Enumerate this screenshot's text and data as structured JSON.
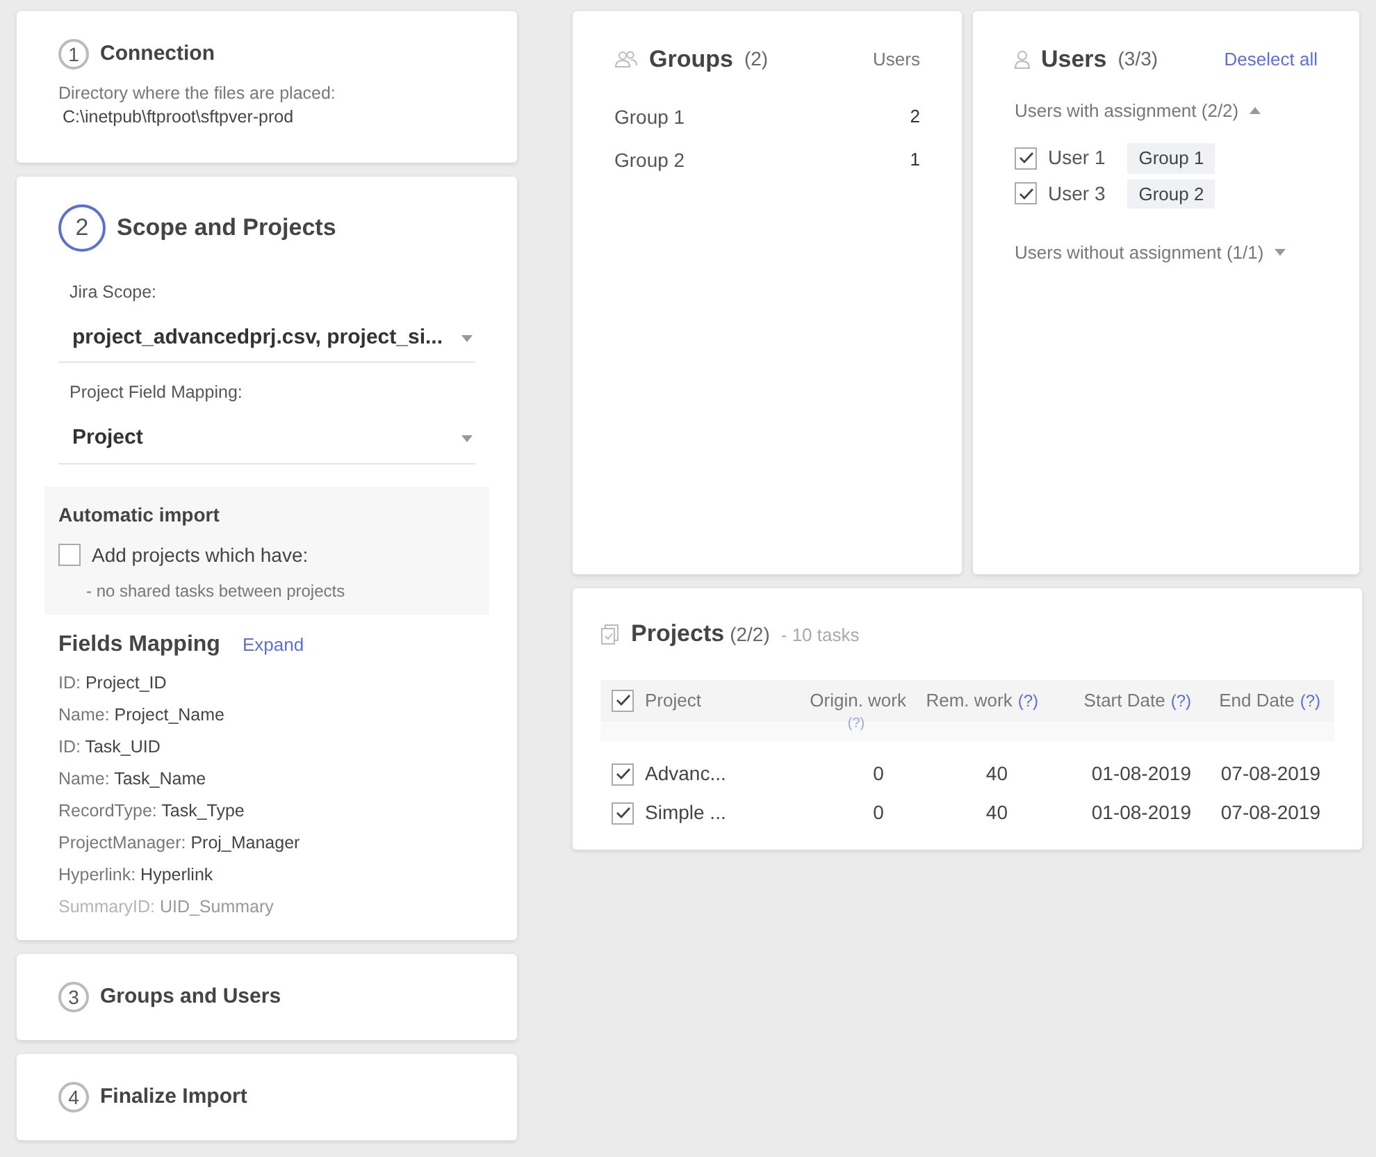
{
  "steps": [
    {
      "number": "1",
      "title": "Connection",
      "active": false,
      "kind": "connection",
      "label": "Directory where the files are placed:",
      "path": "C:\\inetpub\\ftproot\\sftpver-prod"
    },
    {
      "number": "2",
      "title": "Scope and Projects",
      "active": true,
      "kind": "scope",
      "fields": [
        {
          "label": "Jira Scope:",
          "value": "project_advancedprj.csv, project_si..."
        },
        {
          "label": "Project Field Mapping:",
          "value": "Project"
        }
      ],
      "auto_import": {
        "title": "Automatic import",
        "checkbox_label": "Add projects which have:",
        "checked": false,
        "note": "- no shared tasks between projects"
      },
      "fields_mapping": {
        "title": "Fields Mapping",
        "action": "Expand",
        "rows": [
          {
            "key": "ID:",
            "value": "Project_ID"
          },
          {
            "key": "Name:",
            "value": "Project_Name"
          },
          {
            "key": "ID:",
            "value": "Task_UID"
          },
          {
            "key": "Name:",
            "value": "Task_Name"
          },
          {
            "key": "RecordType:",
            "value": "Task_Type"
          },
          {
            "key": "ProjectManager:",
            "value": "Proj_Manager"
          },
          {
            "key": "Hyperlink:",
            "value": "Hyperlink"
          },
          {
            "key": "SummaryID:",
            "value": "UID_Summary"
          }
        ]
      }
    },
    {
      "number": "3",
      "title": "Groups and Users",
      "active": false,
      "kind": "collapsed"
    },
    {
      "number": "4",
      "title": "Finalize Import",
      "active": false,
      "kind": "collapsed"
    }
  ],
  "groups": {
    "title": "Groups",
    "count": "(2)",
    "column": "Users",
    "items": [
      {
        "name": "Group 1",
        "users": "2"
      },
      {
        "name": "Group 2",
        "users": "1"
      }
    ]
  },
  "users": {
    "title": "Users",
    "count": "(3/3)",
    "action": "Deselect all",
    "sections": [
      {
        "label": "Users with assignment (2/2)",
        "expanded": true,
        "users": [
          {
            "name": "User 1",
            "group": "Group 1",
            "checked": true
          },
          {
            "name": "User 3",
            "group": "Group 2",
            "checked": true
          }
        ]
      },
      {
        "label": "Users without assignment (1/1)",
        "expanded": false
      }
    ]
  },
  "projects": {
    "title": "Projects",
    "count": "(2/2)",
    "summary": "- 10 tasks",
    "all_checked": true,
    "columns": [
      {
        "label": "Project"
      },
      {
        "label": "Origin. work",
        "help": "(?)"
      },
      {
        "label": "Rem. work",
        "help": "(?)"
      },
      {
        "label": "Start Date",
        "help": "(?)"
      },
      {
        "label": "End Date",
        "help": "(?)"
      }
    ],
    "rows": [
      {
        "checked": true,
        "cells": [
          "Advanc...",
          "0",
          "40",
          "01-08-2019",
          "07-08-2019"
        ]
      },
      {
        "checked": true,
        "cells": [
          "Simple ...",
          "0",
          "40",
          "01-08-2019",
          "07-08-2019"
        ]
      }
    ]
  }
}
